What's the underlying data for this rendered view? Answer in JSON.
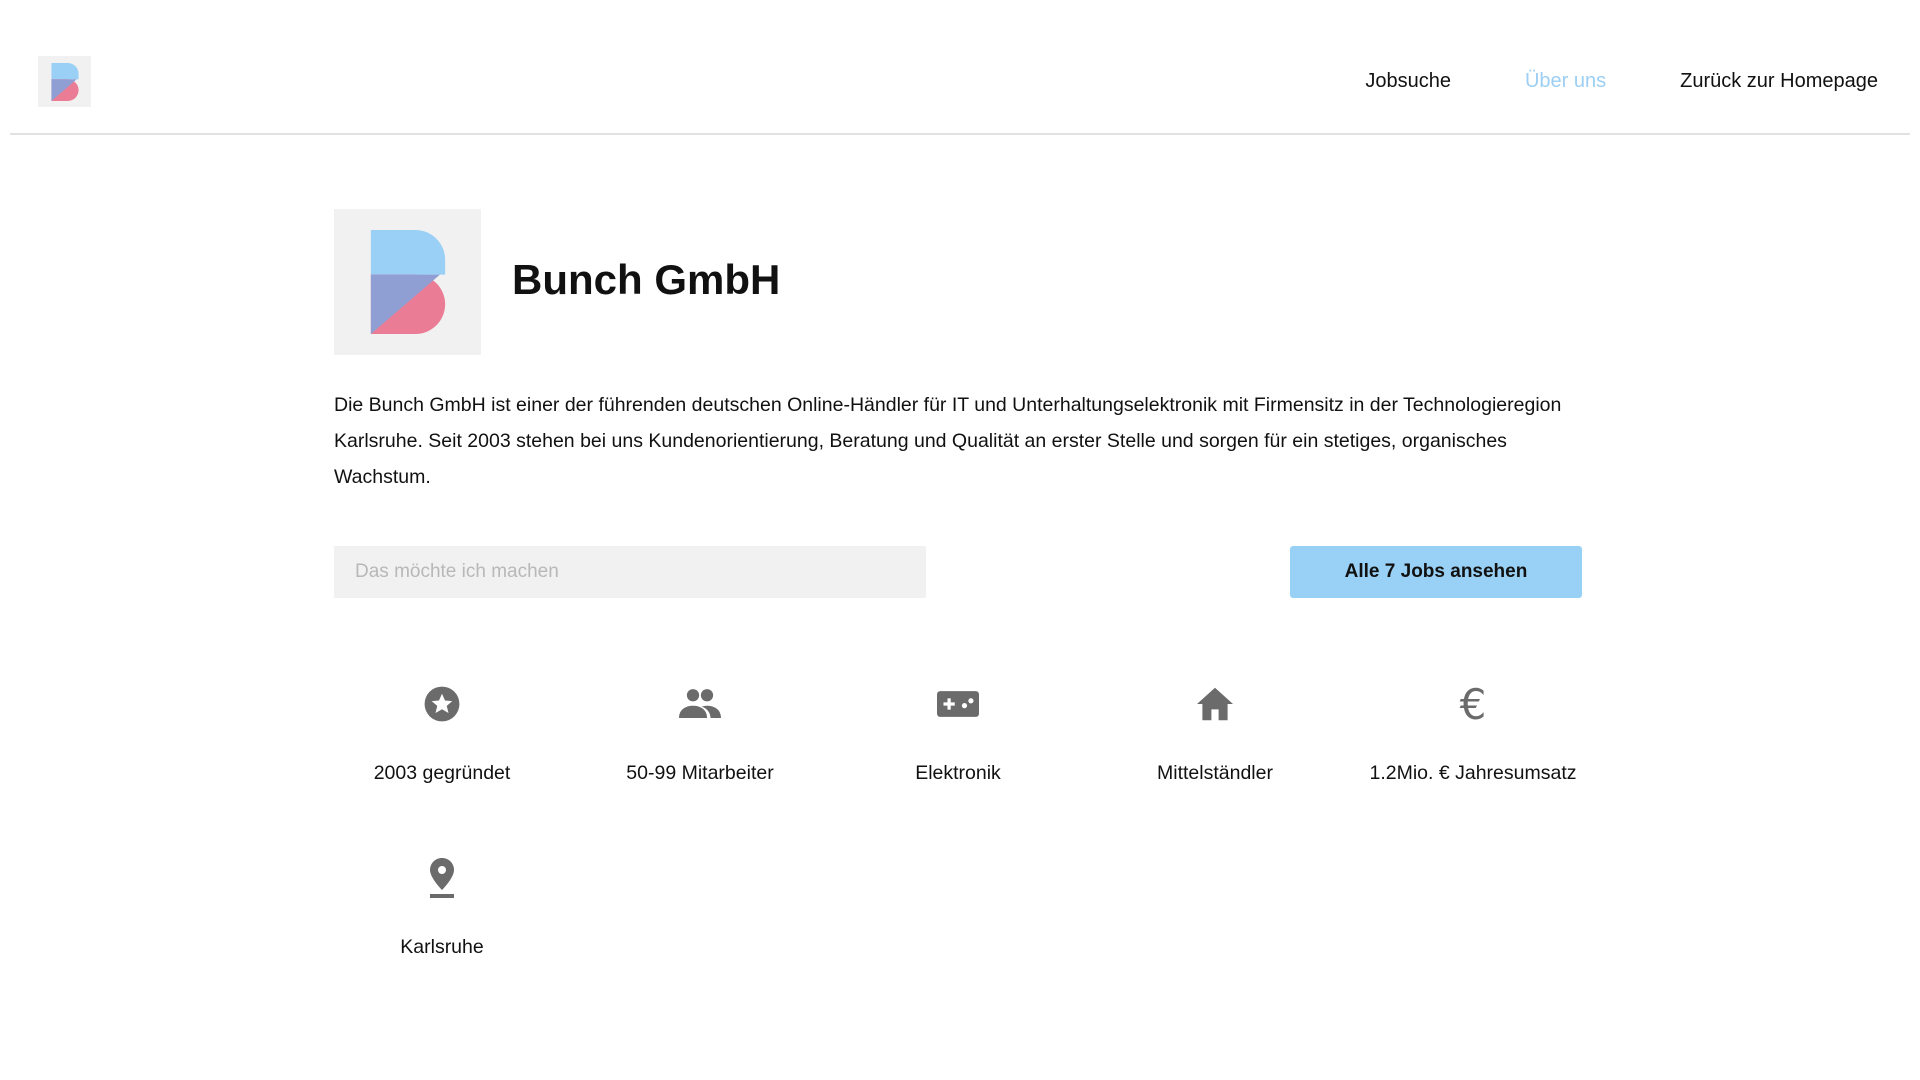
{
  "header": {
    "nav": [
      {
        "label": "Jobsuche"
      },
      {
        "label": "Über uns",
        "active": true
      },
      {
        "label": "Zurück zur Homepage"
      }
    ]
  },
  "company": {
    "name": "Bunch GmbH",
    "description": "Die Bunch GmbH ist einer der führenden deutschen Online-Händler für IT und Unterhaltungselektronik mit Firmensitz in der Technologieregion Karlsruhe. Seit 2003 stehen bei uns Kundenorientierung, Beratung und Qualität an erster Stelle und sorgen für ein stetiges, organisches Wachstum."
  },
  "search": {
    "placeholder": "Das möchte ich machen",
    "value": ""
  },
  "jobs_button": "Alle 7 Jobs ansehen",
  "features": [
    {
      "icon": "star-circle-icon",
      "label": "2003 gegründet"
    },
    {
      "icon": "people-icon",
      "label": "50-99 Mitarbeiter"
    },
    {
      "icon": "gamepad-icon",
      "label": "Elektronik"
    },
    {
      "icon": "home-icon",
      "label": "Mittelständler"
    },
    {
      "icon": "euro-icon",
      "label": "1.2Mio. € Jahresumsatz"
    },
    {
      "icon": "location-pin-icon",
      "label": "Karlsruhe"
    }
  ],
  "colors": {
    "accent": "#99d0f5",
    "icon": "#6b6b6b",
    "logo_blue": "#9ad0f5",
    "logo_pink": "#ea7d95",
    "logo_purple": "#8f9fd3"
  }
}
